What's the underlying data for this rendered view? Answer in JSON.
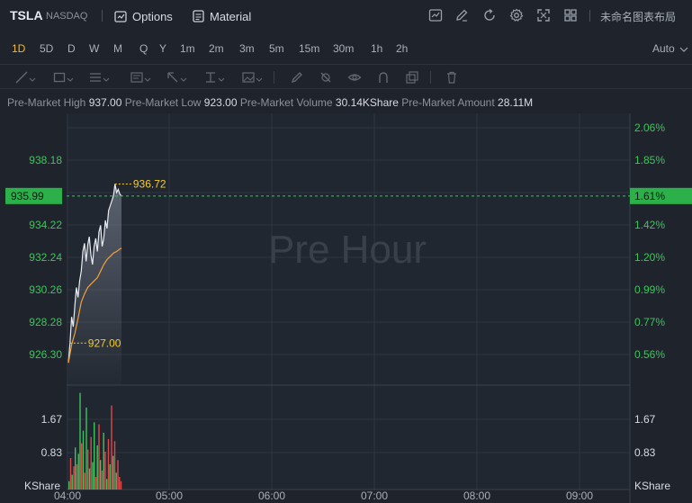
{
  "header": {
    "symbol": "TSLA",
    "exchange": "NASDAQ",
    "options_label": "Options",
    "material_label": "Material",
    "layout_label": "未命名图表布局",
    "right_icons": [
      "chart-icon",
      "pen-icon",
      "refresh-icon",
      "settings-icon",
      "fullscreen-icon",
      "grid-icon"
    ]
  },
  "periods": {
    "items": [
      "1D",
      "5D",
      "D",
      "W",
      "M",
      "Q",
      "Y",
      "1m",
      "2m",
      "3m",
      "5m",
      "15m",
      "30m",
      "1h",
      "2h"
    ],
    "active": "1D",
    "auto_label": "Auto"
  },
  "drawing_tools": [
    "line-tool-icon",
    "rectangle-tool-icon",
    "text-lines-tool-icon",
    "arrow-tool-icon",
    "measure-tool-icon",
    "annotation-tool-icon",
    "brush-icon",
    "visibility-icon",
    "magnet-icon",
    "copy-icon",
    "trash-icon"
  ],
  "info": {
    "high_label": "Pre-Market High",
    "high_value": "937.00",
    "low_label": "Pre-Market Low",
    "low_value": "923.00",
    "volume_label": "Pre-Market Volume",
    "volume_value": "30.14KShare",
    "amount_label": "Pre-Market Amount",
    "amount_value": "28.11M"
  },
  "watermark": "Pre Hour",
  "colors": {
    "background": "#1f242c",
    "grid": "#2e353f",
    "price_line": "#e8ecf2",
    "avg_line": "#f0a23a",
    "up": "#3ec45b",
    "down": "#e04848",
    "label_yellow": "#f5cb2b",
    "current_badge": "#2bb04a",
    "active_period": "#f5b826"
  },
  "chart_data": {
    "type": "line",
    "x_ticks": [
      "04:00",
      "05:00",
      "06:00",
      "07:00",
      "08:00",
      "09:00"
    ],
    "price_ticks": [
      "938.18",
      "936.20",
      "934.22",
      "932.24",
      "930.26",
      "928.28",
      "926.30"
    ],
    "pct_ticks": [
      "2.06%",
      "1.85%",
      "1.64%",
      "1.42%",
      "1.20%",
      "0.99%",
      "0.77%",
      "0.56%"
    ],
    "current_price": "935.99",
    "current_pct": "1.61%",
    "high_label": "936.72",
    "low_label": "927.00",
    "volume_ticks": [
      "1.67",
      "0.83"
    ],
    "volume_unit": "KShare",
    "price_series": [
      [
        0,
        925.8
      ],
      [
        1,
        927.0
      ],
      [
        2,
        928.6
      ],
      [
        3,
        928.0
      ],
      [
        4,
        929.3
      ],
      [
        5,
        930.4
      ],
      [
        6,
        929.8
      ],
      [
        7,
        930.8
      ],
      [
        8,
        931.4
      ],
      [
        9,
        932.6
      ],
      [
        10,
        933.1
      ],
      [
        11,
        932.0
      ],
      [
        12,
        933.0
      ],
      [
        13,
        933.5
      ],
      [
        14,
        932.4
      ],
      [
        15,
        931.8
      ],
      [
        16,
        932.9
      ],
      [
        17,
        933.4
      ],
      [
        18,
        932.6
      ],
      [
        19,
        933.8
      ],
      [
        20,
        934.2
      ],
      [
        21,
        932.9
      ],
      [
        22,
        933.4
      ],
      [
        23,
        934.5
      ],
      [
        24,
        934.0
      ],
      [
        25,
        935.1
      ],
      [
        26,
        935.4
      ],
      [
        27,
        935.7
      ],
      [
        28,
        936.0
      ],
      [
        29,
        936.72
      ],
      [
        30,
        936.2
      ],
      [
        31,
        936.4
      ],
      [
        32,
        936.1
      ],
      [
        33,
        935.99
      ]
    ],
    "avg_series": [
      [
        0,
        925.8
      ],
      [
        2,
        926.9
      ],
      [
        4,
        927.6
      ],
      [
        6,
        928.5
      ],
      [
        8,
        929.5
      ],
      [
        10,
        930.0
      ],
      [
        12,
        930.4
      ],
      [
        14,
        930.6
      ],
      [
        16,
        930.8
      ],
      [
        18,
        931.0
      ],
      [
        20,
        931.4
      ],
      [
        22,
        931.8
      ],
      [
        24,
        932.1
      ],
      [
        26,
        932.3
      ],
      [
        28,
        932.5
      ],
      [
        30,
        932.6
      ],
      [
        32,
        932.75
      ],
      [
        33,
        932.8
      ]
    ],
    "volume_series": [
      {
        "v": 0.2,
        "c": "up"
      },
      {
        "v": 0.75,
        "c": "down"
      },
      {
        "v": 0.35,
        "c": "up"
      },
      {
        "v": 0.55,
        "c": "down"
      },
      {
        "v": 1.0,
        "c": "up"
      },
      {
        "v": 0.6,
        "c": "down"
      },
      {
        "v": 0.85,
        "c": "up"
      },
      {
        "v": 2.3,
        "c": "up"
      },
      {
        "v": 1.1,
        "c": "down"
      },
      {
        "v": 1.4,
        "c": "up"
      },
      {
        "v": 0.4,
        "c": "down"
      },
      {
        "v": 1.95,
        "c": "up"
      },
      {
        "v": 0.95,
        "c": "down"
      },
      {
        "v": 0.5,
        "c": "up"
      },
      {
        "v": 1.25,
        "c": "down"
      },
      {
        "v": 0.65,
        "c": "up"
      },
      {
        "v": 1.6,
        "c": "up"
      },
      {
        "v": 0.3,
        "c": "down"
      },
      {
        "v": 1.05,
        "c": "up"
      },
      {
        "v": 1.55,
        "c": "down"
      },
      {
        "v": 0.7,
        "c": "up"
      },
      {
        "v": 0.45,
        "c": "down"
      },
      {
        "v": 1.35,
        "c": "up"
      },
      {
        "v": 0.9,
        "c": "down"
      },
      {
        "v": 0.25,
        "c": "up"
      },
      {
        "v": 1.2,
        "c": "down"
      },
      {
        "v": 0.6,
        "c": "up"
      },
      {
        "v": 2.0,
        "c": "down"
      },
      {
        "v": 0.8,
        "c": "up"
      },
      {
        "v": 1.15,
        "c": "down"
      },
      {
        "v": 0.4,
        "c": "up"
      },
      {
        "v": 0.7,
        "c": "down"
      },
      {
        "v": 0.3,
        "c": "down"
      },
      {
        "v": 0.2,
        "c": "down"
      }
    ]
  }
}
